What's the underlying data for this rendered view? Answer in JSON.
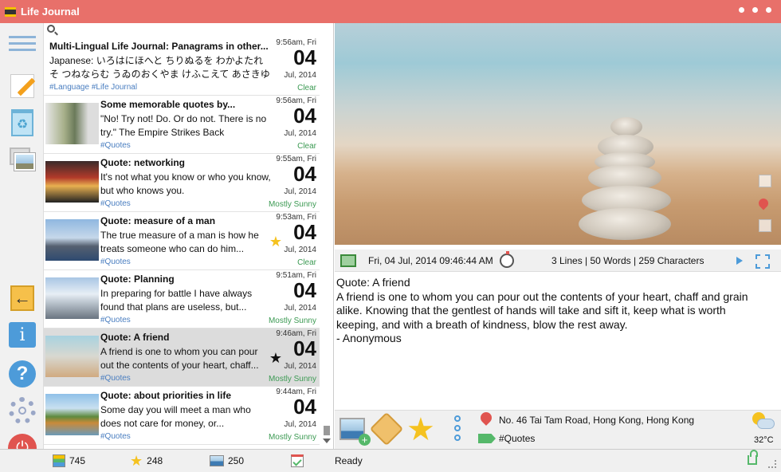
{
  "window": {
    "title": "Life Journal"
  },
  "entries": [
    {
      "title": "Multi-Lingual Life Journal: Panagrams in other...",
      "text": "Japanese: いろはにほへと ちりぬるを わかよたれそ つねならむ うゐのおくやま けふこえて あさきゆめみし ゑひもせす（ん）",
      "tags": "#Language #Life Journal",
      "time": "9:56am, Fri",
      "day": "04",
      "month_year": "Jul, 2014",
      "weather": "Clear",
      "thumb": "none",
      "star": "none"
    },
    {
      "title": "Some memorable quotes by...",
      "text": "\"No! Try not! Do. Or do not. There is no try.\" The Empire Strikes Back",
      "tags": "#Quotes",
      "time": "9:56am, Fri",
      "day": "04",
      "month_year": "Jul, 2014",
      "weather": "Clear",
      "thumb": "yoda-figure",
      "star": "none"
    },
    {
      "title": "Quote: networking",
      "text": "It's not what you know or who you know, but who knows you.",
      "tags": "#Quotes",
      "time": "9:55am, Fri",
      "day": "04",
      "month_year": "Jul, 2014",
      "weather": "Mostly Sunny",
      "thumb": "street-lanterns",
      "star": "none"
    },
    {
      "title": "Quote: measure of a man",
      "text": "The true measure of a man is how he treats someone who can do him...",
      "tags": "#Quotes",
      "time": "9:53am, Fri",
      "day": "04",
      "month_year": "Jul, 2014",
      "weather": "Clear",
      "thumb": "city-skyline",
      "star": "gold"
    },
    {
      "title": "Quote: Planning",
      "text": "In preparing for battle I have always found that plans are useless, but...",
      "tags": "#Quotes",
      "time": "9:51am, Fri",
      "day": "04",
      "month_year": "Jul, 2014",
      "weather": "Mostly Sunny",
      "thumb": "snowy-town",
      "star": "none"
    },
    {
      "title": "Quote: A friend",
      "text": "A friend is one to whom you can pour out the contents of your heart, chaff...",
      "tags": "#Quotes",
      "time": "9:46am, Fri",
      "day": "04",
      "month_year": "Jul, 2014",
      "weather": "Mostly Sunny",
      "thumb": "stacked-stones",
      "star": "black",
      "selected": true
    },
    {
      "title": "Quote: about priorities in life",
      "text": "Some day you will meet a man who does not care for money, or...",
      "tags": "#Quotes",
      "time": "9:44am, Fri",
      "day": "04",
      "month_year": "Jul, 2014",
      "weather": "Mostly Sunny",
      "thumb": "lake-landscape",
      "star": "none"
    }
  ],
  "detail": {
    "date_time": "Fri, 04 Jul, 2014 09:46:44 AM",
    "stats": "3 Lines | 50 Words | 259 Characters",
    "content_title": "Quote: A friend",
    "content_lines": [
      "A friend is one to whom you can pour out the contents of your heart, chaff and grain",
      "alike. Knowing that the gentlest of hands will take and sift it, keep what is worth",
      "keeping, and with a breath of kindness, blow the rest away.",
      "- Anonymous"
    ],
    "location": "No. 46 Tai Tam Road, Hong Kong, Hong Kong",
    "tags": "#Quotes",
    "temperature": "32°C",
    "weather_icon": "partly-cloudy-icon"
  },
  "status": {
    "entries_count": "745",
    "favorites_count": "248",
    "photos_count": "250",
    "state": "Ready"
  },
  "colors": {
    "titlebar": "#E8706A",
    "accent_blue": "#4d9bd9",
    "star_gold": "#f5c220",
    "weather_green": "#3c9a53",
    "tag_blue": "#4a7ec0"
  }
}
